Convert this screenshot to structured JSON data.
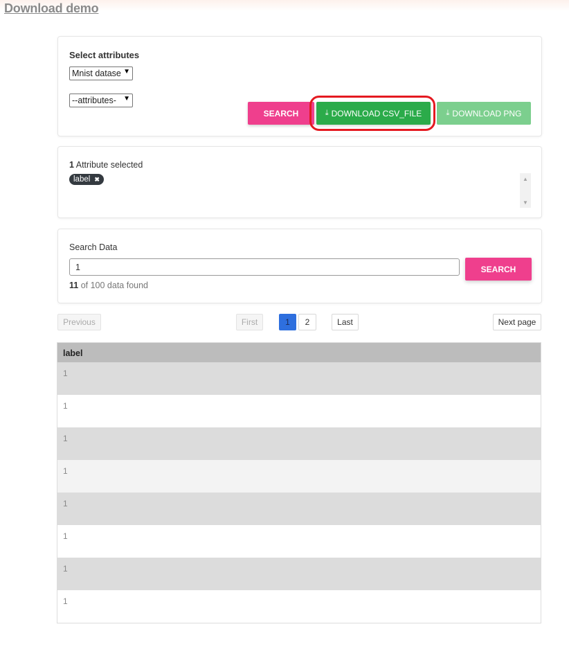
{
  "page": {
    "title": "Download demo"
  },
  "attributes_panel": {
    "heading": "Select attributes",
    "dataset_select": "Mnist datase",
    "attribute_select": "--attributes-",
    "search_label": "SEARCH",
    "download_csv_label": "DOWNLOAD CSV_FILE",
    "download_png_label": "DOWNLOAD PNG"
  },
  "selected_panel": {
    "count": "1",
    "count_text": " Attribute selected",
    "chip_label": "label",
    "chip_close": "✖"
  },
  "search_panel": {
    "label": "Search Data",
    "input_value": "1",
    "button_label": "SEARCH",
    "found_count": "11",
    "found_text": " of 100 data found"
  },
  "pagination": {
    "previous": "Previous",
    "first": "First",
    "pages": [
      "1",
      "2"
    ],
    "last": "Last",
    "next": "Next page"
  },
  "table": {
    "header": "label",
    "rows": [
      "1",
      "1",
      "1",
      "1",
      "1",
      "1",
      "1",
      "1"
    ]
  },
  "colors": {
    "search_button": "#ef3f8d",
    "csv_button": "#2bab4a",
    "png_button": "#7ccf8e",
    "active_page": "#2e6fde",
    "highlight": "#e41920"
  }
}
